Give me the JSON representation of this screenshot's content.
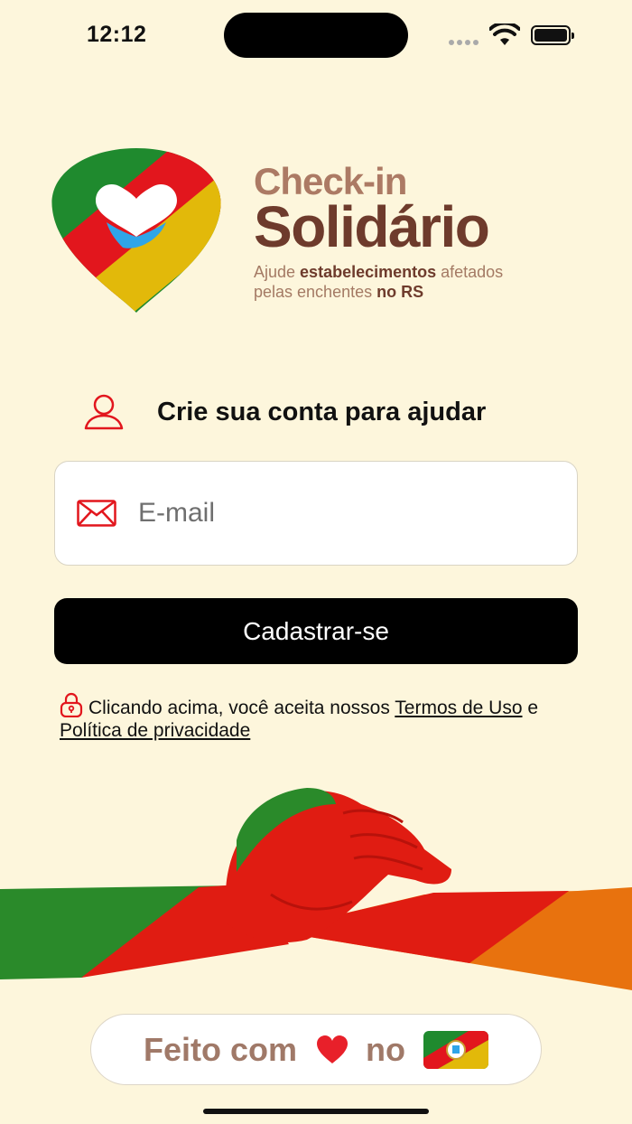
{
  "status_bar": {
    "time": "12:12",
    "icons": [
      "signal-dots-icon",
      "wifi-icon",
      "battery-icon"
    ]
  },
  "brand": {
    "name_top": "Check-in",
    "name_bottom": "Solidário",
    "tagline_1a": "Ajude ",
    "tagline_1b": "estabelecimentos",
    "tagline_1c": " afetados",
    "tagline_2a": "pelas enchentes ",
    "tagline_2b": "no RS",
    "colors": {
      "green": "#1f8a2e",
      "red": "#e2161d",
      "yellow": "#e2b90a",
      "brown": "#6e3b2c",
      "light_brown": "#ac7a64"
    }
  },
  "form": {
    "heading": "Crie sua conta para ajudar",
    "email_placeholder": "E-mail",
    "email_value": "",
    "submit_label": "Cadastrar-se"
  },
  "terms": {
    "prefix": "Clicando acima, você aceita nossos ",
    "terms_link": "Termos de Uso",
    "joiner": " e ",
    "privacy_link": "Política de privacidade"
  },
  "footer": {
    "made_text": "Feito com",
    "in_text": "no",
    "icons": [
      "heart-icon",
      "rs-flag-icon"
    ]
  },
  "background_color": "#fdf6dc"
}
